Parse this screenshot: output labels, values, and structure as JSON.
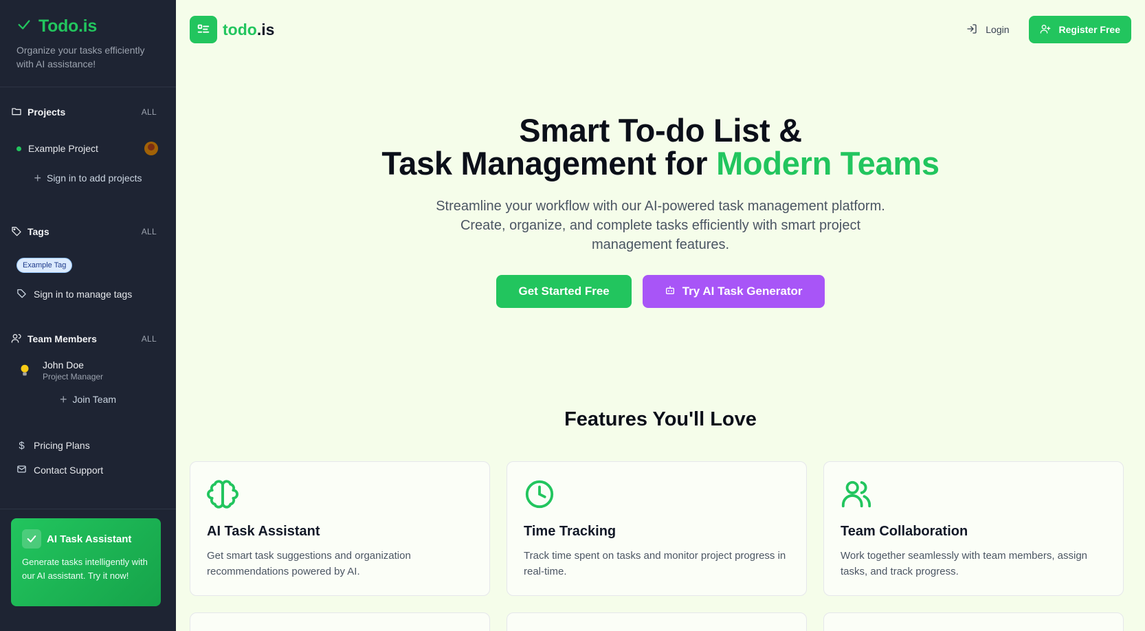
{
  "sidebar": {
    "brand": "Todo.is",
    "tagline": "Organize your tasks efficiently with AI assistance!",
    "projects": {
      "title": "Projects",
      "all_label": "ALL",
      "items": [
        {
          "label": "Example Project"
        }
      ],
      "add_label": "Sign in to add projects"
    },
    "tags": {
      "title": "Tags",
      "all_label": "ALL",
      "items": [
        {
          "label": "Example Tag"
        }
      ],
      "manage_label": "Sign in to manage tags"
    },
    "team": {
      "title": "Team Members",
      "all_label": "ALL",
      "members": [
        {
          "name": "John Doe",
          "role": "Project Manager"
        }
      ],
      "join_label": "Join Team"
    },
    "links": {
      "pricing": "Pricing Plans",
      "support": "Contact Support"
    },
    "ai_card": {
      "title": "AI Task Assistant",
      "text": "Generate tasks intelligently with our AI assistant. Try it now!"
    }
  },
  "header": {
    "logo_main": "todo",
    "logo_suffix": ".is",
    "login_label": "Login",
    "register_label": "Register Free"
  },
  "hero": {
    "title_line1": "Smart To-do List &",
    "title_line2_prefix": "Task Management for ",
    "title_line2_highlight": "Modern Teams",
    "subtitle": "Streamline your workflow with our AI-powered task management platform. Create, organize, and complete tasks efficiently with smart project management features.",
    "cta_primary": "Get Started Free",
    "cta_secondary": "Try AI Task Generator"
  },
  "features": {
    "title": "Features You'll Love",
    "items": [
      {
        "icon": "brain-icon",
        "title": "AI Task Assistant",
        "desc": "Get smart task suggestions and organization recommendations powered by AI."
      },
      {
        "icon": "clock-icon",
        "title": "Time Tracking",
        "desc": "Track time spent on tasks and monitor project progress in real-time."
      },
      {
        "icon": "users-icon",
        "title": "Team Collaboration",
        "desc": "Work together seamlessly with team members, assign tasks, and track progress."
      }
    ]
  },
  "colors": {
    "accent": "#22c55e",
    "purple": "#a855f7",
    "sidebar_bg": "#1e2433",
    "page_bg": "#f5fdea"
  }
}
